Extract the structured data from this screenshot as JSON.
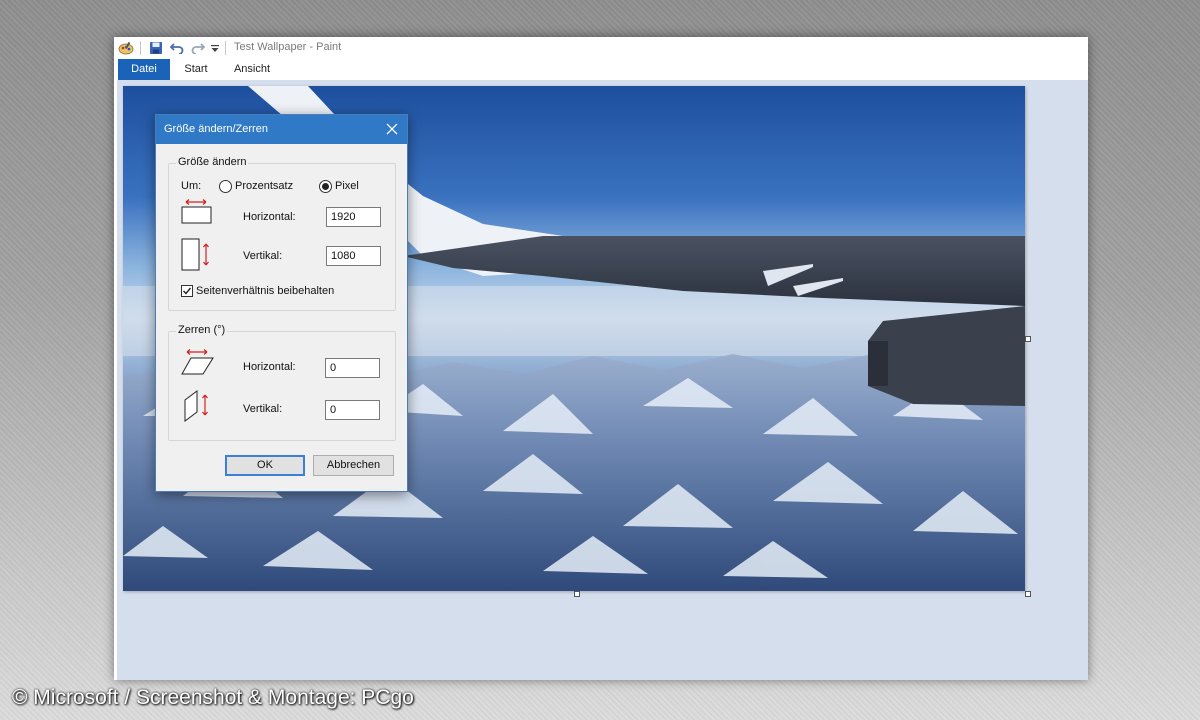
{
  "window": {
    "title": "Test Wallpaper - Paint",
    "quick_access_icons": [
      "paint-app-icon",
      "save-icon",
      "undo-icon",
      "redo-icon",
      "customize-dropdown-icon"
    ],
    "tabs": [
      {
        "label": "Datei",
        "active": true
      },
      {
        "label": "Start",
        "active": false
      },
      {
        "label": "Ansicht",
        "active": false
      }
    ],
    "accent": "#1b63b8",
    "canvas_background": "#d5deed"
  },
  "dialog": {
    "title": "Größe ändern/Zerren",
    "close_icon": "close-icon",
    "resize": {
      "group_label": "Größe ändern",
      "by_label": "Um:",
      "options": [
        {
          "label": "Prozentsatz",
          "selected": false
        },
        {
          "label": "Pixel",
          "selected": true
        }
      ],
      "horizontal_label": "Horizontal:",
      "horizontal_value": "1920",
      "vertical_label": "Vertikal:",
      "vertical_value": "1080",
      "keep_ratio_label": "Seitenverhältnis beibehalten",
      "keep_ratio_checked": true
    },
    "skew": {
      "group_label": "Zerren (°)",
      "horizontal_label": "Horizontal:",
      "horizontal_value": "0",
      "vertical_label": "Vertikal:",
      "vertical_value": "0"
    },
    "buttons": {
      "ok": "OK",
      "cancel": "Abbrechen"
    }
  },
  "credit": "© Microsoft / Screenshot & Montage: PCgo"
}
